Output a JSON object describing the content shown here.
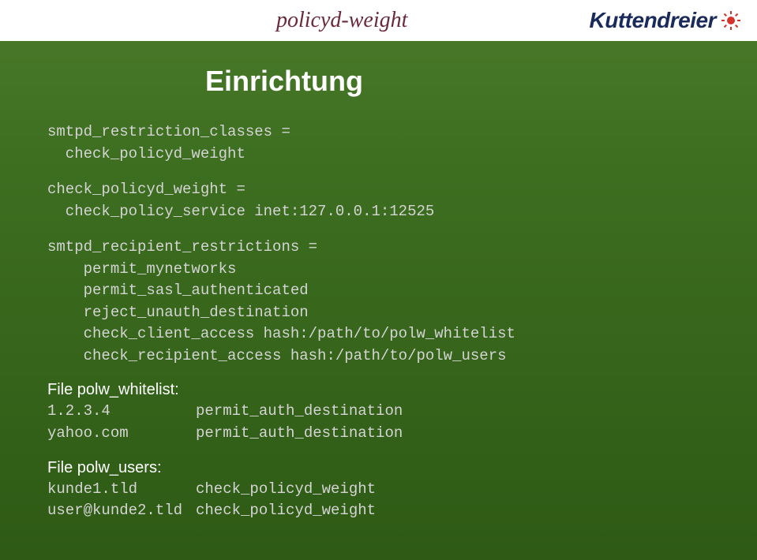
{
  "header": {
    "logo_left": "policyd-weight",
    "logo_right": "Kuttendreier"
  },
  "title": "Einrichtung",
  "code1": "smtpd_restriction_classes =\n  check_policyd_weight",
  "code2": "check_policyd_weight =\n  check_policy_service inet:127.0.0.1:12525",
  "code3": "smtpd_recipient_restrictions =\n    permit_mynetworks\n    permit_sasl_authenticated\n    reject_unauth_destination\n    check_client_access hash:/path/to/polw_whitelist\n    check_recipient_access hash:/path/to/polw_users",
  "file1": {
    "label": "File polw_whitelist:",
    "rows": [
      {
        "col1": "1.2.3.4",
        "col2": "permit_auth_destination"
      },
      {
        "col1": "yahoo.com",
        "col2": "permit_auth_destination"
      }
    ]
  },
  "file2": {
    "label": "File polw_users:",
    "rows": [
      {
        "col1": "kunde1.tld",
        "col2": "check_policyd_weight"
      },
      {
        "col1": "user@kunde2.tld",
        "col2": "check_policyd_weight"
      }
    ]
  }
}
